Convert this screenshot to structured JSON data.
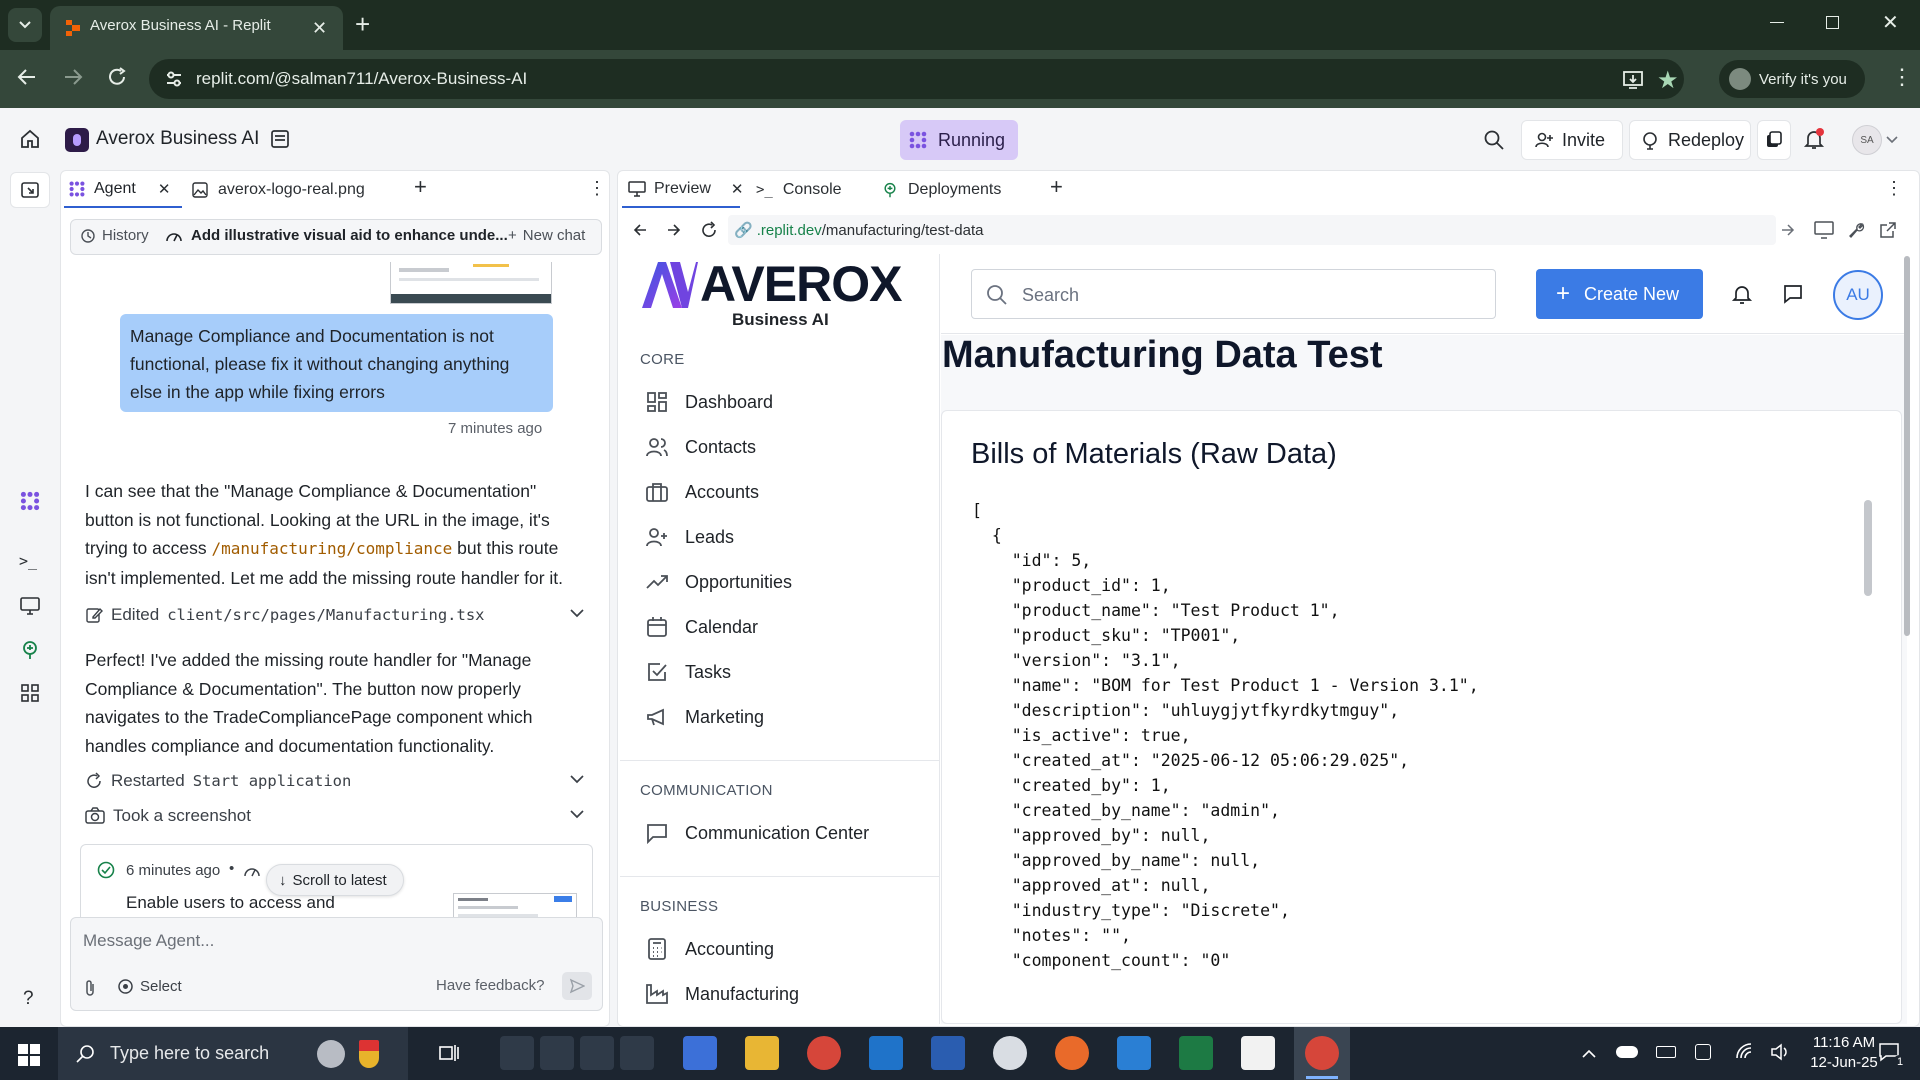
{
  "browser": {
    "tab_title": "Averox Business AI - Replit",
    "url": "replit.com/@salman711/Averox-Business-AI",
    "verify_label": "Verify it's you"
  },
  "replit": {
    "project_name": "Averox Business AI",
    "status": "Running",
    "invite_label": "Invite",
    "redeploy_label": "Redeploy",
    "avatar_initials": "SA"
  },
  "left_tabs": [
    {
      "label": "Agent"
    },
    {
      "label": "averox-logo-real.png"
    }
  ],
  "agent": {
    "history_label": "History",
    "chat_title": "Add illustrative visual aid to enhance unde...",
    "new_chat_label": "New chat",
    "user_message": "Manage Compliance and Documentation is not functional, please fix it without changing anything else in the app while fixing errors",
    "user_message_time": "7 minutes ago",
    "reply_1_a": "I can see that the \"Manage Compliance & Documentation\" button is not functional. Looking at the URL in the image, it's trying to access ",
    "reply_1_code": "/manufacturing/compliance",
    "reply_1_b": " but this route isn't implemented. Let me add the missing route handler for it.",
    "edited_prefix": "Edited",
    "edited_file": "client/src/pages/Manufacturing.tsx",
    "reply_2": "Perfect! I've added the missing route handler for \"Manage Compliance & Documentation\". The button now properly navigates to the TradeCompliancePage component which handles compliance and documentation functionality.",
    "restarted_prefix": "Restarted",
    "restarted_target": "Start application",
    "screenshot_label": "Took a screenshot",
    "checkpoint_time": "6 minutes ago",
    "checkpoint_text": "Enable users to access and",
    "scroll_latest": "Scroll to latest",
    "input_placeholder": "Message Agent...",
    "select_label": "Select",
    "feedback_label": "Have feedback?"
  },
  "right_tabs": [
    {
      "label": "Preview"
    },
    {
      "label": "Console"
    },
    {
      "label": "Deployments"
    }
  ],
  "preview": {
    "url_domain": ".replit.dev",
    "url_path": "/manufacturing/test-data"
  },
  "app": {
    "logo_text": "AVEROX",
    "logo_sub": "Business AI",
    "search_placeholder": "Search",
    "create_new": "Create New",
    "avatar": "AU",
    "page_title": "Manufacturing Data Test",
    "card_title": "Bills of Materials (Raw Data)",
    "sections": [
      {
        "label": "CORE",
        "items": [
          "Dashboard",
          "Contacts",
          "Accounts",
          "Leads",
          "Opportunities",
          "Calendar",
          "Tasks",
          "Marketing"
        ]
      },
      {
        "label": "COMMUNICATION",
        "items": [
          "Communication Center"
        ]
      },
      {
        "label": "BUSINESS",
        "items": [
          "Accounting",
          "Manufacturing"
        ]
      }
    ],
    "json_lines": [
      "[",
      "  {",
      "    \"id\": 5,",
      "    \"product_id\": 1,",
      "    \"product_name\": \"Test Product 1\",",
      "    \"product_sku\": \"TP001\",",
      "    \"version\": \"3.1\",",
      "    \"name\": \"BOM for Test Product 1 - Version 3.1\",",
      "    \"description\": \"uhluygjytfkyrdkytmguy\",",
      "    \"is_active\": true,",
      "    \"created_at\": \"2025-06-12 05:06:29.025\",",
      "    \"created_by\": 1,",
      "    \"created_by_name\": \"admin\",",
      "    \"approved_by\": null,",
      "    \"approved_by_name\": null,",
      "    \"approved_at\": null,",
      "    \"industry_type\": \"Discrete\",",
      "    \"notes\": \"\",",
      "    \"component_count\": \"0\""
    ]
  },
  "taskbar": {
    "search_placeholder": "Type here to search",
    "time": "11:16 AM",
    "date": "12-Jun-25",
    "notification_count": "1"
  }
}
